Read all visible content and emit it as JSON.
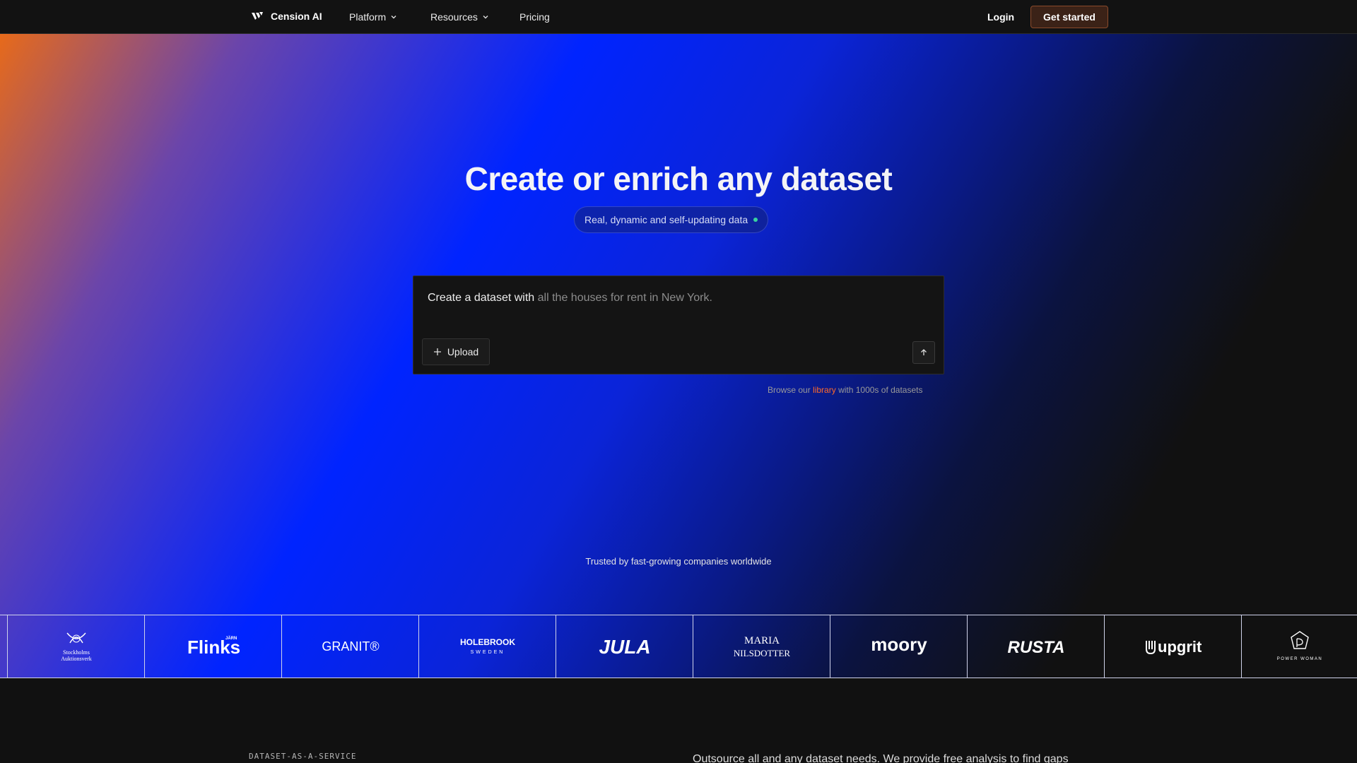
{
  "header": {
    "brand_name": "Cension AI",
    "nav": [
      {
        "label": "Platform",
        "has_dropdown": true
      },
      {
        "label": "Resources",
        "has_dropdown": true
      },
      {
        "label": "Pricing",
        "has_dropdown": false
      }
    ],
    "login_label": "Login",
    "cta_label": "Get started"
  },
  "hero": {
    "title": "Create or enrich any dataset",
    "pill_text": "Real, dynamic and self-updating data",
    "prompt": {
      "lead": "Create a dataset with",
      "placeholder": "all the houses for rent in New York.",
      "upload_label": "Upload"
    },
    "browse": {
      "prefix": "Browse our",
      "link": "library",
      "suffix": "with 1000s of datasets"
    },
    "trusted_text": "Trusted by fast-growing companies worldwide"
  },
  "logos": [
    {
      "name": "Stockholms Auktionsverk",
      "line1": "Stockholms",
      "line2": "Auktionsverk"
    },
    {
      "name": "Flinks",
      "text": "Flinks",
      "small": "JÄRN"
    },
    {
      "name": "GRANIT",
      "text": "GRANIT®"
    },
    {
      "name": "HOLEBROOK SWEDEN",
      "line1": "HOLEBROOK",
      "line2": "SWEDEN"
    },
    {
      "name": "JULA",
      "text": "JULA"
    },
    {
      "name": "MARIA NILSDOTTER",
      "line1": "MARIA",
      "line2": "NILSDOTTER"
    },
    {
      "name": "moory",
      "text": "moory"
    },
    {
      "name": "RUSTA",
      "text": "RUSTA"
    },
    {
      "name": "upgrit",
      "text": "upgrit"
    },
    {
      "name": "POWER WOMAN",
      "text": "POWER WOMAN"
    }
  ],
  "lower": {
    "eyebrow": "DATASET-AS-A-SERVICE",
    "text": "Outsource all and any dataset needs. We provide free analysis to find gaps"
  },
  "colors": {
    "accent_orange": "#ff6a2a",
    "cta_bg": "#3b2217",
    "status_dot": "#38d39f",
    "page_bg": "#111111"
  }
}
